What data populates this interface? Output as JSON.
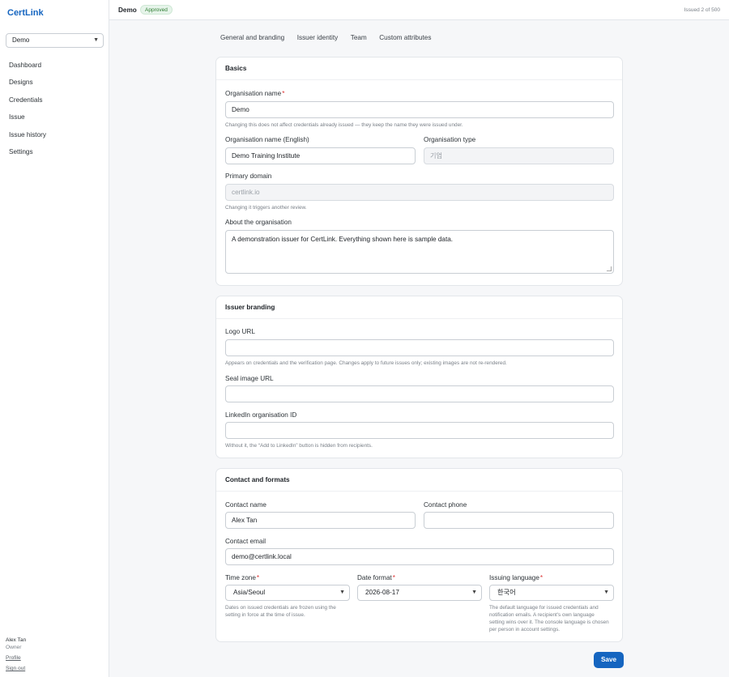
{
  "app": {
    "brand": "CertLink"
  },
  "sidebar": {
    "org_select_value": "Demo",
    "items": [
      {
        "label": "Dashboard"
      },
      {
        "label": "Designs"
      },
      {
        "label": "Credentials"
      },
      {
        "label": "Issue"
      },
      {
        "label": "Issue history"
      },
      {
        "label": "Settings"
      }
    ],
    "user": {
      "name": "Alex Tan",
      "role": "Owner",
      "profile_link": "Profile",
      "signout_link": "Sign out"
    }
  },
  "topbar": {
    "org_name": "Demo",
    "status_badge": "Approved",
    "issued_count": "Issued 2 of 500"
  },
  "tabs": [
    {
      "label": "General and branding"
    },
    {
      "label": "Issuer identity"
    },
    {
      "label": "Team"
    },
    {
      "label": "Custom attributes"
    }
  ],
  "basics": {
    "title": "Basics",
    "org_name_label": "Organisation name",
    "org_name_value": "Demo",
    "org_name_help": "Changing this does not affect credentials already issued — they keep the name they were issued under.",
    "org_name_en_label": "Organisation name (English)",
    "org_name_en_value": "Demo Training Institute",
    "org_type_label": "Organisation type",
    "org_type_placeholder": "기업",
    "domain_label": "Primary domain",
    "domain_placeholder": "certlink.io",
    "domain_help": "Changing it triggers another review.",
    "about_label": "About the organisation",
    "about_value": "A demonstration issuer for CertLink. Everything shown here is sample data."
  },
  "branding": {
    "title": "Issuer branding",
    "logo_label": "Logo URL",
    "logo_value": "",
    "logo_help": "Appears on credentials and the verification page. Changes apply to future issues only; existing images are not re-rendered.",
    "seal_label": "Seal image URL",
    "seal_value": "",
    "linkedin_label": "LinkedIn organisation ID",
    "linkedin_value": "",
    "linkedin_help": "Without it, the “Add to LinkedIn” button is hidden from recipients."
  },
  "contact": {
    "title": "Contact and formats",
    "name_label": "Contact name",
    "name_value": "Alex Tan",
    "phone_label": "Contact phone",
    "phone_value": "",
    "email_label": "Contact email",
    "email_value": "demo@certlink.local",
    "timezone_label": "Time zone",
    "timezone_value": "Asia/Seoul",
    "timezone_help": "Dates on issued credentials are frozen using the setting in force at the time of issue.",
    "date_format_label": "Date format",
    "date_format_value": "2026-08-17",
    "language_label": "Issuing language",
    "language_value": "한국어",
    "language_help": "The default language for issued credentials and notification emails. A recipient's own language setting wins over it. The console language is chosen per person in account settings."
  },
  "actions": {
    "save_label": "Save"
  },
  "colors": {
    "accent": "#1565c0",
    "approved_badge": "#2e7d32",
    "required_mark": "#dd3333"
  }
}
